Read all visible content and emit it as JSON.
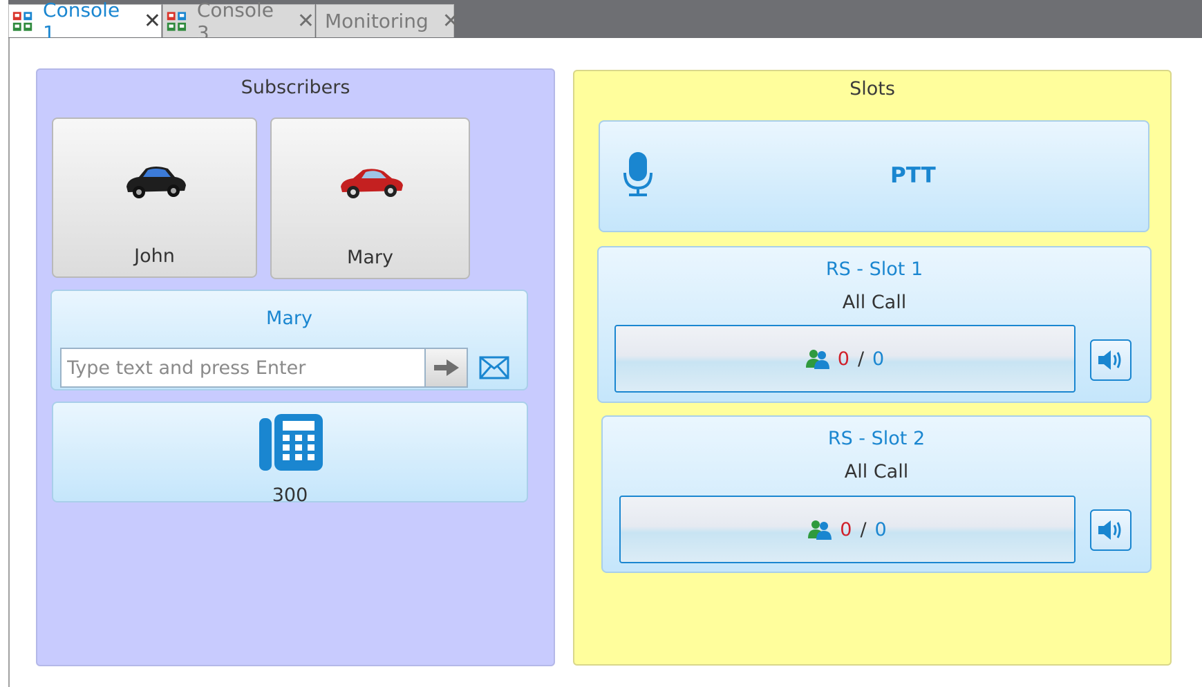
{
  "tabs": [
    {
      "label": "Console 1",
      "active": true,
      "icon": "console-icon"
    },
    {
      "label": "Console 3",
      "active": false,
      "icon": "console-icon"
    },
    {
      "label": "Monitoring",
      "active": false,
      "icon": null
    }
  ],
  "tab_close_glyph": "✕",
  "subscribers": {
    "title": "Subscribers",
    "cards": [
      {
        "name": "John",
        "icon": "black-car-icon",
        "color": "#202020"
      },
      {
        "name": "Mary",
        "icon": "red-car-icon",
        "color": "#c42020"
      }
    ],
    "chat": {
      "title": "Mary",
      "placeholder": "Type text and press Enter",
      "send_icon": "arrow-right-icon",
      "mail_icon": "envelope-icon"
    },
    "phone": {
      "label": "300",
      "icon": "desk-phone-icon"
    }
  },
  "slots": {
    "title": "Slots",
    "ptt": {
      "label": "PTT",
      "icon": "microphone-icon"
    },
    "items": [
      {
        "name": "RS - Slot 1",
        "mode": "All Call",
        "active": "0",
        "separator": "/",
        "total": "0"
      },
      {
        "name": "RS - Slot 2",
        "mode": "All Call",
        "active": "0",
        "separator": "/",
        "total": "0"
      }
    ]
  },
  "colors": {
    "accent": "#1a86d0",
    "subscribers_bg": "#c8cbfe",
    "slots_bg": "#fffe9c",
    "count_active": "#d0202a"
  }
}
